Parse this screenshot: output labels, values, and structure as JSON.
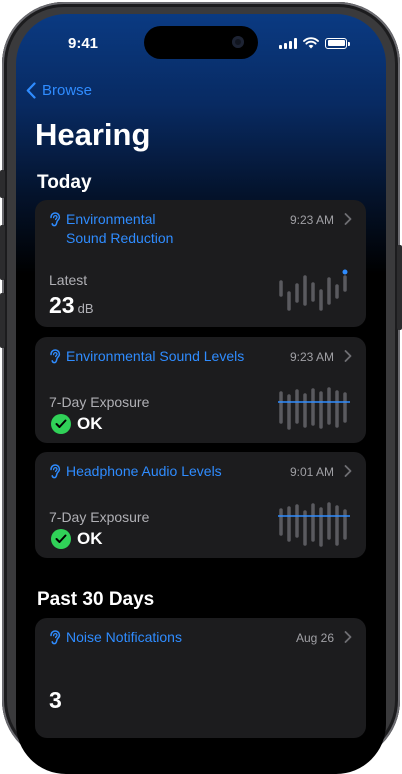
{
  "status": {
    "time": "9:41"
  },
  "nav": {
    "back_label": "Browse"
  },
  "page": {
    "title": "Hearing"
  },
  "sections": {
    "today": "Today",
    "past_30_days": "Past 30 Days"
  },
  "cards": {
    "env_reduction": {
      "title_line1": "Environmental",
      "title_line2": "Sound Reduction",
      "time": "9:23 AM",
      "label": "Latest",
      "value": "23",
      "unit": "dB"
    },
    "env_levels": {
      "title": "Environmental Sound Levels",
      "time": "9:23 AM",
      "label": "7-Day Exposure",
      "status": "OK"
    },
    "headphone": {
      "title": "Headphone Audio Levels",
      "time": "9:01 AM",
      "label": "7-Day Exposure",
      "status": "OK"
    },
    "noise": {
      "title": "Noise Notifications",
      "time": "Aug 26",
      "value": "3"
    }
  },
  "icons": {
    "ear": "ear-icon",
    "back": "chevron-left-icon",
    "disclosure": "chevron-right-icon",
    "ok": "checkmark-circle-icon"
  },
  "colors": {
    "accent": "#2f8cff",
    "ok": "#30d158",
    "card": "#1c1c1e"
  }
}
